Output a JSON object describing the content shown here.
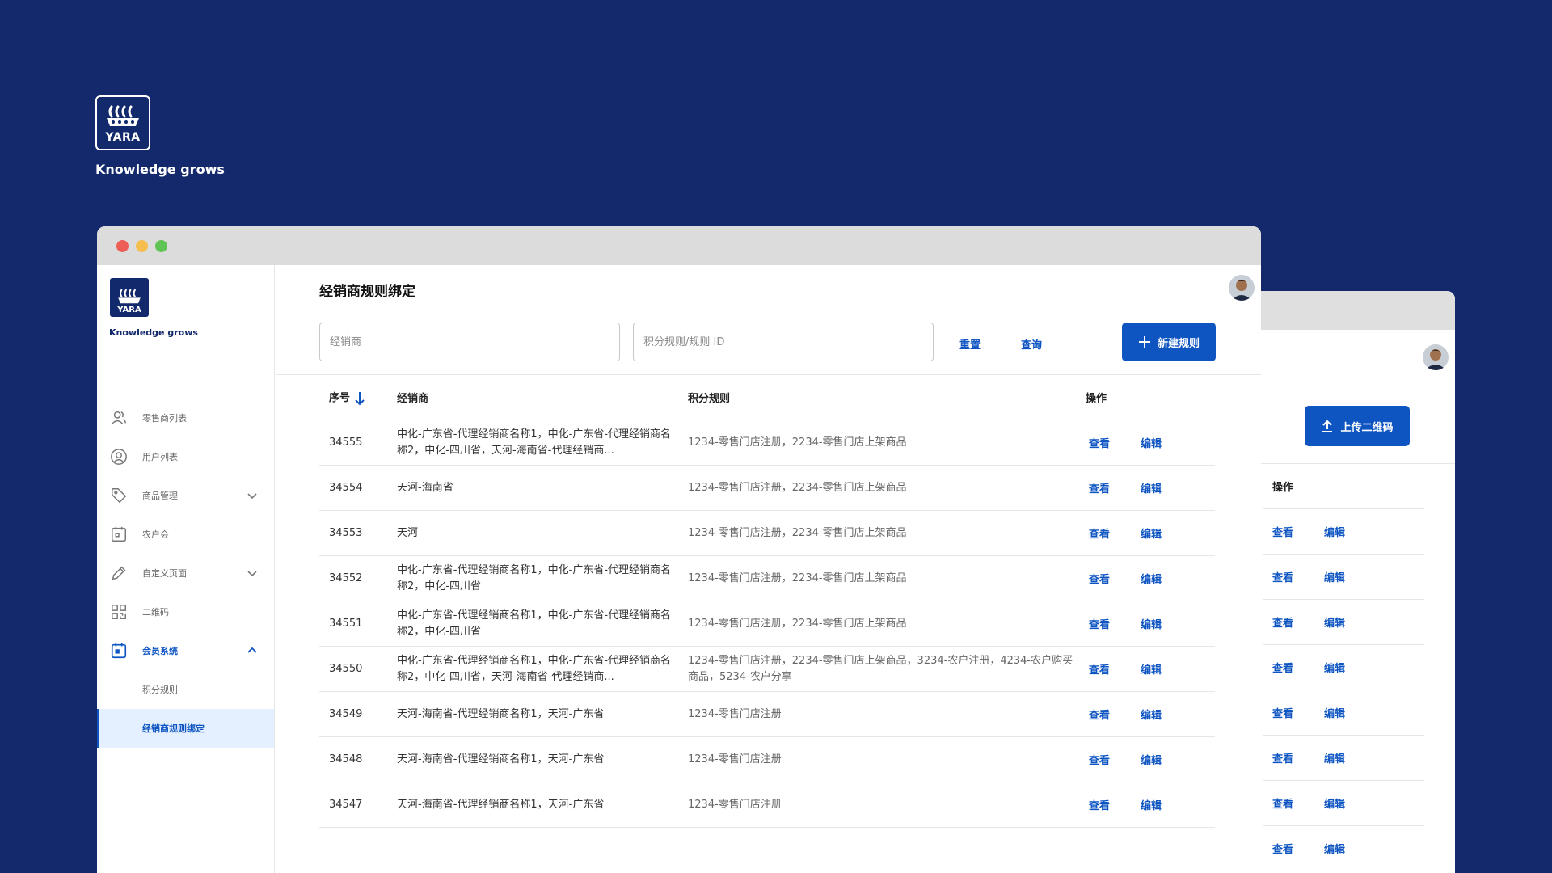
{
  "brand": {
    "logo_word": "YARA",
    "tagline": "Knowledge grows",
    "color": "#12296c"
  },
  "colors": {
    "background": "#13296b",
    "accent": "#0e55c2",
    "active_bg": "#e4f0ff"
  },
  "sidebar": {
    "items": [
      {
        "label": "零售商列表",
        "icon": "users-icon"
      },
      {
        "label": "用户列表",
        "icon": "user-circle-icon"
      },
      {
        "label": "商品管理",
        "icon": "tag-icon",
        "expandable": true
      },
      {
        "label": "农户会",
        "icon": "calendar-icon"
      },
      {
        "label": "自定义页面",
        "icon": "pencil-icon",
        "expandable": true
      },
      {
        "label": "二维码",
        "icon": "qr-code-icon"
      },
      {
        "label": "会员系统",
        "icon": "calendar-active-icon",
        "expanded": true
      }
    ],
    "sub_items": [
      {
        "label": "积分规则"
      },
      {
        "label": "经销商规则绑定",
        "active": true
      }
    ]
  },
  "main": {
    "title": "经销商规则绑定",
    "filters": {
      "dealer_placeholder": "经销商",
      "rule_placeholder": "积分规则/规则 ID",
      "reset_label": "重置",
      "query_label": "查询",
      "new_label": "新建规则"
    },
    "table": {
      "columns": {
        "id": "序号",
        "dealer": "经销商",
        "rule": "积分规则",
        "ops": "操作"
      },
      "view_label": "查看",
      "edit_label": "编辑",
      "rows": [
        {
          "id": "34555",
          "dealer": "中化-广东省-代理经销商名称1，中化-广东省-代理经销商名称2，中化-四川省，天河-海南省-代理经销商...",
          "rule": "1234-零售门店注册，2234-零售门店上架商品"
        },
        {
          "id": "34554",
          "dealer": "天河-海南省",
          "rule": "1234-零售门店注册，2234-零售门店上架商品"
        },
        {
          "id": "34553",
          "dealer": "天河",
          "rule": "1234-零售门店注册，2234-零售门店上架商品"
        },
        {
          "id": "34552",
          "dealer": "中化-广东省-代理经销商名称1，中化-广东省-代理经销商名称2，中化-四川省",
          "rule": "1234-零售门店注册，2234-零售门店上架商品"
        },
        {
          "id": "34551",
          "dealer": "中化-广东省-代理经销商名称1，中化-广东省-代理经销商名称2，中化-四川省",
          "rule": "1234-零售门店注册，2234-零售门店上架商品"
        },
        {
          "id": "34550",
          "dealer": "中化-广东省-代理经销商名称1，中化-广东省-代理经销商名称2，中化-四川省，天河-海南省-代理经销商...",
          "rule": "1234-零售门店注册，2234-零售门店上架商品，3234-农户注册，4234-农户购买商品，5234-农户分享"
        },
        {
          "id": "34549",
          "dealer": "天河-海南省-代理经销商名称1，天河-广东省",
          "rule": "1234-零售门店注册"
        },
        {
          "id": "34548",
          "dealer": "天河-海南省-代理经销商名称1，天河-广东省",
          "rule": "1234-零售门店注册"
        },
        {
          "id": "34547",
          "dealer": "天河-海南省-代理经销商名称1，天河-广东省",
          "rule": "1234-零售门店注册"
        }
      ]
    }
  },
  "back_window": {
    "upload_label": "上传二维码",
    "ops_header": "操作",
    "view_label": "查看",
    "edit_label": "编辑",
    "row_count": 8
  }
}
